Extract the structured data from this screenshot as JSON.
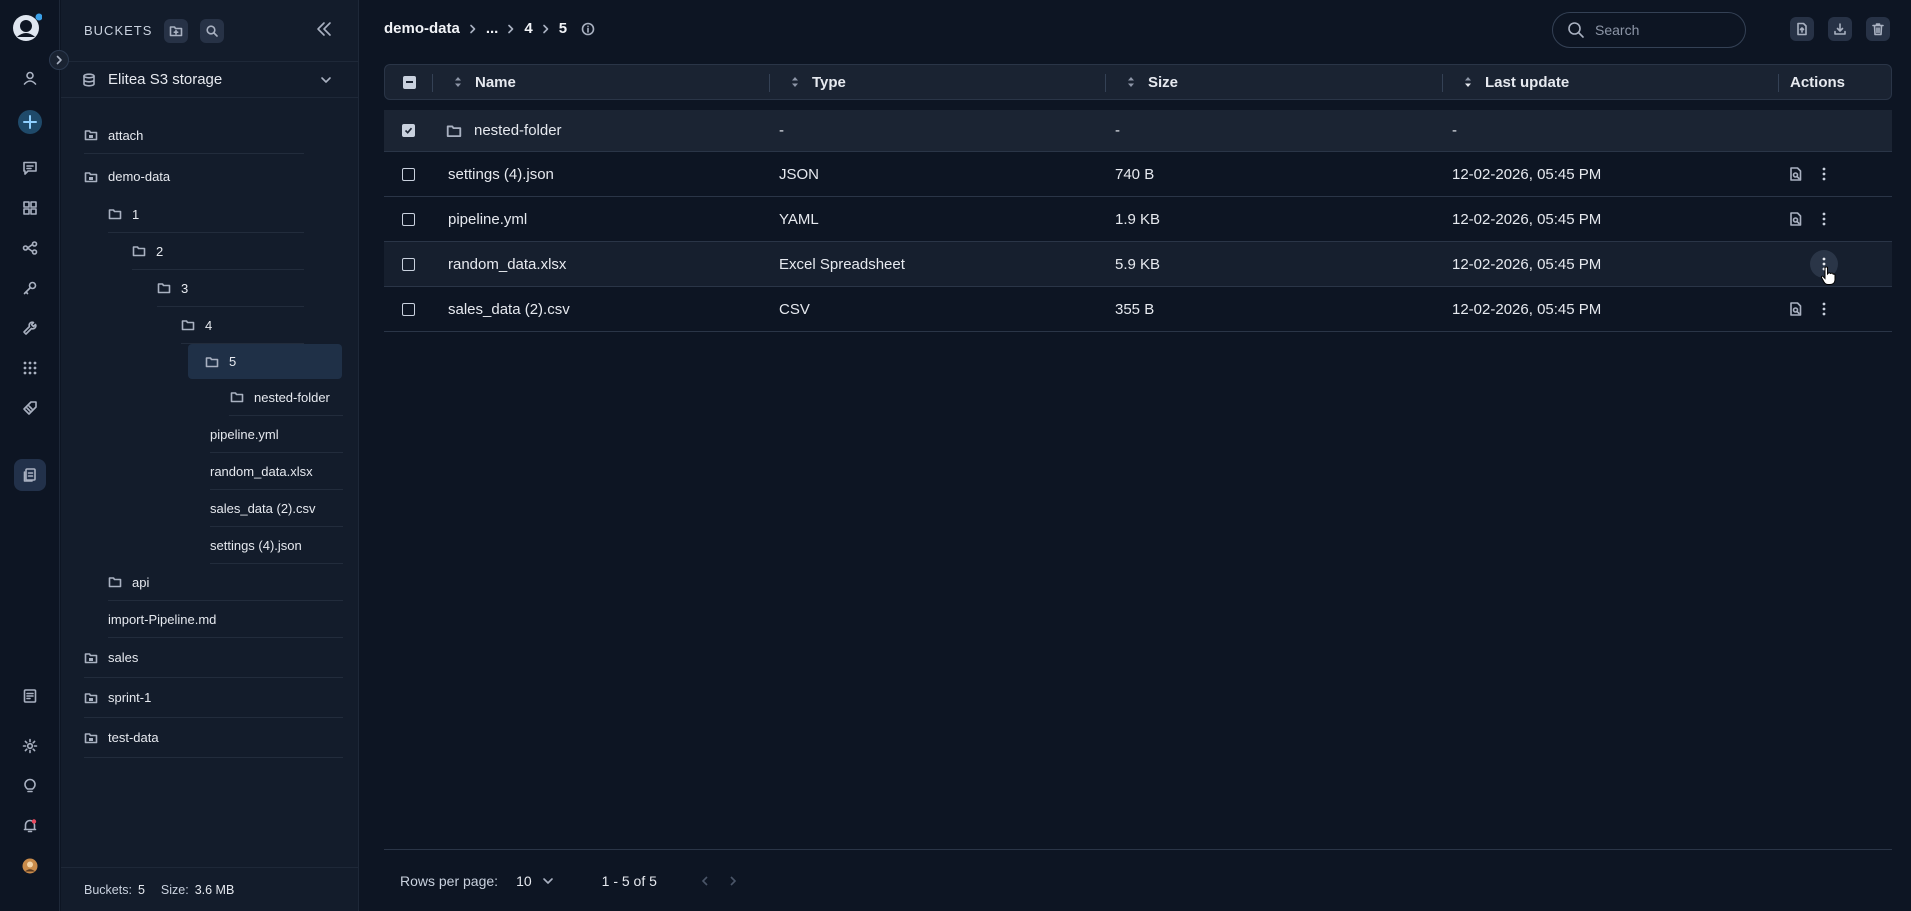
{
  "sidebar": {
    "title": "BUCKETS",
    "storage": "Elitea S3 storage",
    "tree": [
      {
        "label": "attach"
      },
      {
        "label": "demo-data"
      },
      {
        "label": "1"
      },
      {
        "label": "2"
      },
      {
        "label": "3"
      },
      {
        "label": "4"
      },
      {
        "label": "5"
      },
      {
        "label": "nested-folder"
      },
      {
        "label": "pipeline.yml"
      },
      {
        "label": "random_data.xlsx"
      },
      {
        "label": "sales_data (2).csv"
      },
      {
        "label": "settings (4).json"
      },
      {
        "label": "api"
      },
      {
        "label": "import-Pipeline.md"
      },
      {
        "label": "sales"
      },
      {
        "label": "sprint-1"
      },
      {
        "label": "test-data"
      }
    ],
    "footer": {
      "buckets_label": "Buckets:",
      "buckets_value": "5",
      "size_label": "Size:",
      "size_value": "3.6 MB"
    }
  },
  "breadcrumb": [
    "demo-data",
    "...",
    "4",
    "5"
  ],
  "search": {
    "placeholder": "Search"
  },
  "table": {
    "headers": {
      "name": "Name",
      "type": "Type",
      "size": "Size",
      "updated": "Last update",
      "actions": "Actions"
    },
    "rows": [
      {
        "name": "nested-folder",
        "type": "-",
        "size": "-",
        "updated": "-",
        "checked": true
      },
      {
        "name": "settings (4).json",
        "type": "JSON",
        "size": "740 B",
        "updated": "12-02-2026, 05:45 PM",
        "checked": false
      },
      {
        "name": "pipeline.yml",
        "type": "YAML",
        "size": "1.9 KB",
        "updated": "12-02-2026, 05:45 PM",
        "checked": false
      },
      {
        "name": "random_data.xlsx",
        "type": "Excel Spreadsheet",
        "size": "5.9 KB",
        "updated": "12-02-2026, 05:45 PM",
        "checked": false
      },
      {
        "name": "sales_data (2).csv",
        "type": "CSV",
        "size": "355 B",
        "updated": "12-02-2026, 05:45 PM",
        "checked": false
      }
    ]
  },
  "pagination": {
    "rows_label": "Rows per page:",
    "rows_value": "10",
    "range": "1 - 5 of 5"
  },
  "colors": {
    "background": "#0d1523",
    "sidebar": "#131c2b",
    "selected": "#1f3047",
    "accent": "#3aa0e8"
  }
}
